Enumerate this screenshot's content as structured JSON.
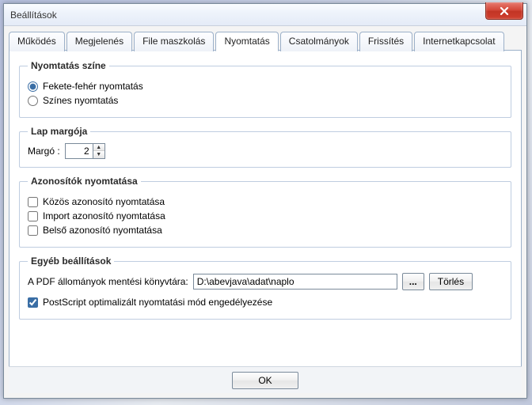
{
  "window": {
    "title": "Beállítások"
  },
  "tabs": [
    {
      "label": "Működés"
    },
    {
      "label": "Megjelenés"
    },
    {
      "label": "File maszkolás"
    },
    {
      "label": "Nyomtatás"
    },
    {
      "label": "Csatolmányok"
    },
    {
      "label": "Frissítés"
    },
    {
      "label": "Internetkapcsolat"
    }
  ],
  "groups": {
    "print_color": {
      "legend": "Nyomtatás színe",
      "option_bw": "Fekete-fehér nyomtatás",
      "option_color": "Színes nyomtatás"
    },
    "page_margin": {
      "legend": "Lap margója",
      "label": "Margó :",
      "value": "2"
    },
    "ids": {
      "legend": "Azonosítók nyomtatása",
      "common": "Közös azonosító nyomtatása",
      "import": "Import azonosító nyomtatása",
      "internal": "Belső azonosító nyomtatása"
    },
    "other": {
      "legend": "Egyéb beállítások",
      "pdf_label": "A PDF állományok mentési könyvtára:",
      "pdf_path": "D:\\abevjava\\adat\\naplo",
      "browse": "...",
      "clear": "Törlés",
      "postscript": "PostScript optimalizált nyomtatási mód engedélyezése"
    }
  },
  "buttons": {
    "ok": "OK"
  }
}
